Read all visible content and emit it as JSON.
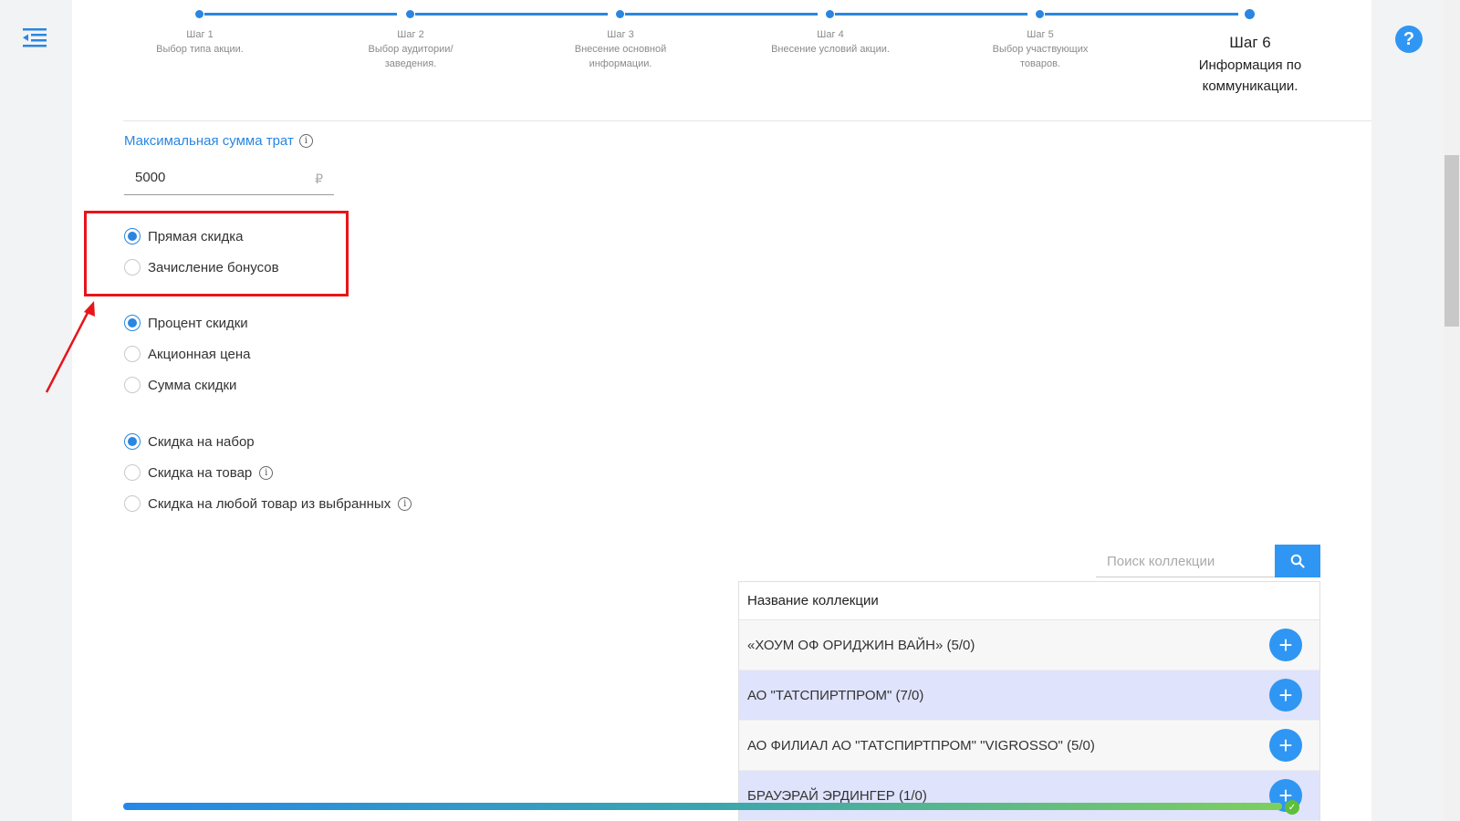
{
  "steps": [
    {
      "num": "Шаг 1",
      "label": "Выбор типа акции."
    },
    {
      "num": "Шаг 2",
      "label": "Выбор аудитории/заведения."
    },
    {
      "num": "Шаг 3",
      "label": "Внесение основной информации."
    },
    {
      "num": "Шаг 4",
      "label": "Внесение условий акции."
    },
    {
      "num": "Шаг 5",
      "label": "Выбор участвующих товаров."
    },
    {
      "num": "Шаг 6",
      "label": "Информация по коммуникации."
    }
  ],
  "max_sum": {
    "label": "Максимальная сумма трат",
    "value": "5000",
    "currency": "₽"
  },
  "discount_type": [
    {
      "label": "Прямая скидка",
      "checked": true
    },
    {
      "label": "Зачисление бонусов",
      "checked": false
    }
  ],
  "discount_kind": [
    {
      "label": "Процент скидки",
      "checked": true
    },
    {
      "label": "Акционная цена",
      "checked": false
    },
    {
      "label": "Сумма скидки",
      "checked": false
    }
  ],
  "discount_scope": [
    {
      "label": "Скидка на набор",
      "checked": true
    },
    {
      "label": "Скидка на товар",
      "checked": false
    },
    {
      "label": "Скидка на любой товар из выбранных",
      "checked": false
    }
  ],
  "search": {
    "placeholder": "Поиск коллекции"
  },
  "collections": {
    "header": "Название коллекции",
    "rows": [
      "«ХОУМ ОФ ОРИДЖИН ВАЙН» (5/0)",
      "АО \"ТАТСПИРТПРОМ\" (7/0)",
      "АО ФИЛИАЛ АО \"ТАТСПИРТПРОМ\" \"VIGROSSO\" (5/0)",
      "БРАУЭРАЙ ЭРДИНГЕР (1/0)"
    ]
  },
  "progress": {
    "percent": 100
  },
  "icons": {
    "menu": "menu-collapse-icon",
    "help": "question-icon",
    "info": "info-icon",
    "search": "search-icon",
    "add": "plus-icon",
    "check": "check-icon"
  },
  "colors": {
    "accent": "#2a86e0",
    "button": "#2f96f3",
    "highlight": "#e8141a",
    "row_alt": "#dfe3fb"
  }
}
